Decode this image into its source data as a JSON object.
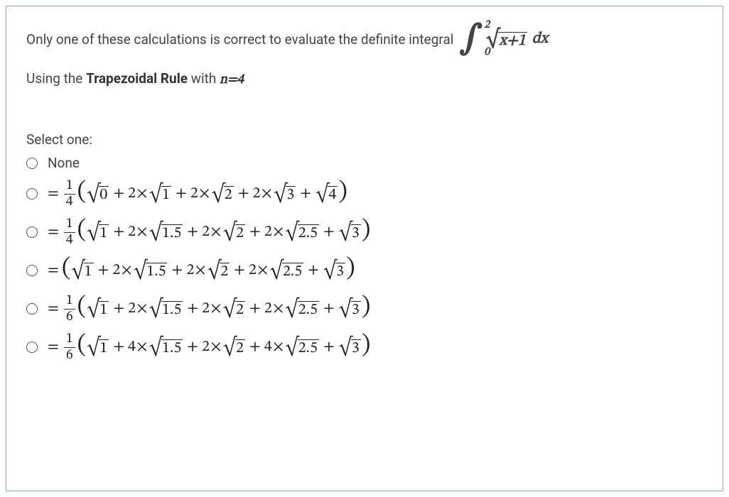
{
  "question": {
    "intro_text": "Only one of these calculations is correct to evaluate the definite integral",
    "integral": {
      "upper": "2",
      "lower": "0",
      "radicand": "x+1",
      "dx": "dx"
    },
    "using_prefix": "Using the ",
    "rule_name": "Trapezoidal Rule",
    "with_text": " with ",
    "n_text": "n=4",
    "select_label": "Select one:"
  },
  "options": [
    {
      "type": "text",
      "text": "None"
    },
    {
      "type": "math",
      "frac_num": "1",
      "frac_den": "4",
      "terms": [
        "0",
        "1",
        "2",
        "3",
        "4"
      ],
      "coeffs": [
        "",
        "2",
        "2",
        "2",
        ""
      ]
    },
    {
      "type": "math",
      "frac_num": "1",
      "frac_den": "4",
      "terms": [
        "1",
        "1.5",
        "2",
        "2.5",
        "3"
      ],
      "coeffs": [
        "",
        "2",
        "2",
        "2",
        ""
      ]
    },
    {
      "type": "math",
      "frac_num": "",
      "frac_den": "",
      "terms": [
        "1",
        "1.5",
        "2",
        "2.5",
        "3"
      ],
      "coeffs": [
        "",
        "2",
        "2",
        "2",
        ""
      ]
    },
    {
      "type": "math",
      "frac_num": "1",
      "frac_den": "6",
      "terms": [
        "1",
        "1.5",
        "2",
        "2.5",
        "3"
      ],
      "coeffs": [
        "",
        "2",
        "2",
        "2",
        ""
      ]
    },
    {
      "type": "math",
      "frac_num": "1",
      "frac_den": "6",
      "terms": [
        "1",
        "1.5",
        "2",
        "2.5",
        "3"
      ],
      "coeffs": [
        "",
        "4",
        "2",
        "4",
        ""
      ]
    }
  ]
}
